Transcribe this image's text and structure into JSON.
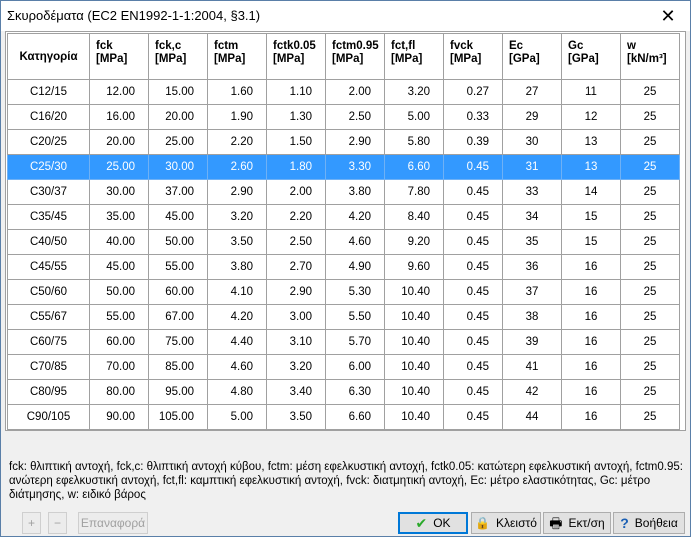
{
  "window": {
    "title": "Σκυροδέματα (EC2 EN1992-1-1:2004, §3.1)",
    "close_glyph": "✕"
  },
  "table": {
    "headers": [
      {
        "name": "Κατηγορία",
        "unit": ""
      },
      {
        "name": "fck",
        "unit": "[MPa]"
      },
      {
        "name": "fck,c",
        "unit": "[MPa]"
      },
      {
        "name": "fctm",
        "unit": "[MPa]"
      },
      {
        "name": "fctk0.05",
        "unit": "[MPa]"
      },
      {
        "name": "fctm0.95",
        "unit": "[MPa]"
      },
      {
        "name": "fct,fl",
        "unit": "[MPa]"
      },
      {
        "name": "fvck",
        "unit": "[MPa]"
      },
      {
        "name": "Ec",
        "unit": "[GPa]"
      },
      {
        "name": "Gc",
        "unit": "[GPa]"
      },
      {
        "name": "w",
        "unit": "[kN/m³]"
      }
    ],
    "selected_index": 2,
    "rows": [
      [
        "C12/15",
        "12.00",
        "15.00",
        "1.60",
        "1.10",
        "2.00",
        "3.20",
        "0.27",
        "27",
        "11",
        "25"
      ],
      [
        "C16/20",
        "16.00",
        "20.00",
        "1.90",
        "1.30",
        "2.50",
        "5.00",
        "0.33",
        "29",
        "12",
        "25"
      ],
      [
        "C20/25",
        "20.00",
        "25.00",
        "2.20",
        "1.50",
        "2.90",
        "5.80",
        "0.39",
        "30",
        "13",
        "25"
      ],
      [
        "C25/30",
        "25.00",
        "30.00",
        "2.60",
        "1.80",
        "3.30",
        "6.60",
        "0.45",
        "31",
        "13",
        "25"
      ],
      [
        "C30/37",
        "30.00",
        "37.00",
        "2.90",
        "2.00",
        "3.80",
        "7.80",
        "0.45",
        "33",
        "14",
        "25"
      ],
      [
        "C35/45",
        "35.00",
        "45.00",
        "3.20",
        "2.20",
        "4.20",
        "8.40",
        "0.45",
        "34",
        "15",
        "25"
      ],
      [
        "C40/50",
        "40.00",
        "50.00",
        "3.50",
        "2.50",
        "4.60",
        "9.20",
        "0.45",
        "35",
        "15",
        "25"
      ],
      [
        "C45/55",
        "45.00",
        "55.00",
        "3.80",
        "2.70",
        "4.90",
        "9.60",
        "0.45",
        "36",
        "16",
        "25"
      ],
      [
        "C50/60",
        "50.00",
        "60.00",
        "4.10",
        "2.90",
        "5.30",
        "10.40",
        "0.45",
        "37",
        "16",
        "25"
      ],
      [
        "C55/67",
        "55.00",
        "67.00",
        "4.20",
        "3.00",
        "5.50",
        "10.40",
        "0.45",
        "38",
        "16",
        "25"
      ],
      [
        "C60/75",
        "60.00",
        "75.00",
        "4.40",
        "3.10",
        "5.70",
        "10.40",
        "0.45",
        "39",
        "16",
        "25"
      ],
      [
        "C70/85",
        "70.00",
        "85.00",
        "4.60",
        "3.20",
        "6.00",
        "10.40",
        "0.45",
        "41",
        "16",
        "25"
      ],
      [
        "C80/95",
        "80.00",
        "95.00",
        "4.80",
        "3.40",
        "6.30",
        "10.40",
        "0.45",
        "42",
        "16",
        "25"
      ],
      [
        "C90/105",
        "90.00",
        "105.00",
        "5.00",
        "3.50",
        "6.60",
        "10.40",
        "0.45",
        "44",
        "16",
        "25"
      ]
    ]
  },
  "description": "fck: θλιπτική αντοχή, fck,c: θλιπτική αντοχή κύβου, fctm: μέση εφελκυστική αντοχή, fctk0.05: κατώτερη εφελκυστική αντοχή, fctm0.95: ανώτερη εφελκυστική αντοχή, fct,fl: καμπτική εφελκυστική αντοχή, fvck: διατμητική αντοχή, Ec: μέτρο ελαστικότητας, Gc: μέτρο διάτμησης, w: ειδικό βάρος",
  "footer": {
    "add_glyph": "+",
    "remove_glyph": "−",
    "restore_label": "Επαναφορά",
    "ok_label": "OK",
    "ok_glyph": "✔",
    "close_label": "Κλειστό",
    "close_glyph": "🔒",
    "print_label": "Εκτ/ση",
    "print_glyph": "🖶",
    "help_label": "Βοήθεια",
    "help_glyph": "?"
  },
  "colors": {
    "selection": "#3399ff",
    "ok_border": "#0078d7",
    "help_icon": "#1a5fb4",
    "ok_check": "#2aa92a"
  }
}
